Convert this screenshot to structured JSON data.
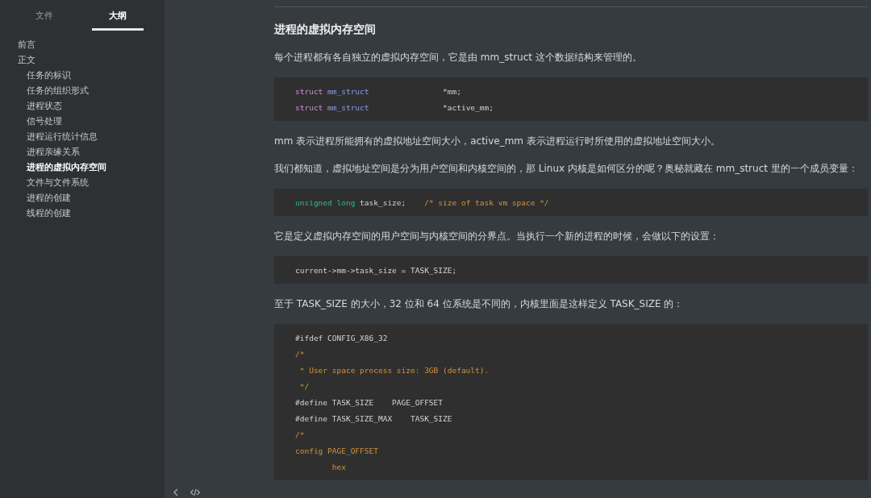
{
  "sidebar": {
    "tabs": [
      {
        "label": "文件",
        "selected": false
      },
      {
        "label": "大纲",
        "selected": true
      }
    ],
    "outline": [
      {
        "label": "前言",
        "selected": false
      },
      {
        "label": "正文",
        "selected": false,
        "children": [
          {
            "label": "任务的标识",
            "selected": false
          },
          {
            "label": "任务的组织形式",
            "selected": false
          },
          {
            "label": "进程状态",
            "selected": false
          },
          {
            "label": "信号处理",
            "selected": false
          },
          {
            "label": "进程运行统计信息",
            "selected": false
          },
          {
            "label": "进程亲缘关系",
            "selected": false
          },
          {
            "label": "进程的虚拟内存空间",
            "selected": true
          },
          {
            "label": "文件与文件系统",
            "selected": false
          },
          {
            "label": "进程的创建",
            "selected": false
          },
          {
            "label": "线程的创建",
            "selected": false
          }
        ]
      }
    ]
  },
  "content": [
    {
      "kind": "heading",
      "text": "进程的虚拟内存空间"
    },
    {
      "kind": "paragraph",
      "text": "每个进程都有各自独立的虚拟内存空间，它是由 mm_struct 这个数据结构来管理的。"
    },
    {
      "kind": "code",
      "lines": [
        [
          {
            "kind": "keyword",
            "text": "struct"
          },
          {
            "kind": "type",
            "text": " mm_struct"
          },
          {
            "kind": "plain",
            "text": "                *mm;"
          }
        ],
        [
          {
            "kind": "keyword",
            "text": "struct"
          },
          {
            "kind": "type",
            "text": " mm_struct"
          },
          {
            "kind": "plain",
            "text": "                *active_mm;"
          }
        ]
      ]
    },
    {
      "kind": "paragraph",
      "text": "mm 表示进程所能拥有的虚拟地址空间大小，active_mm 表示进程运行时所使用的虚拟地址空间大小。"
    },
    {
      "kind": "paragraph",
      "text": "我们都知道，虚拟地址空间是分为用户空间和内核空间的，那 Linux 内核是如何区分的呢？奥秘就藏在 mm_struct 里的一个成员变量："
    },
    {
      "kind": "code",
      "lines": [
        [
          {
            "kind": "builtin",
            "text": "unsigned long"
          },
          {
            "kind": "plain",
            "text": " task_size;    "
          },
          {
            "kind": "comment",
            "text": "/* size of task vm space */"
          }
        ]
      ]
    },
    {
      "kind": "paragraph",
      "text": "它是定义虚拟内存空间的用户空间与内核空间的分界点。当执行一个新的进程的时候，会做以下的设置："
    },
    {
      "kind": "code",
      "lines": [
        [
          {
            "kind": "plain",
            "text": "current->mm->task_size = TASK_SIZE;"
          }
        ]
      ]
    },
    {
      "kind": "paragraph",
      "text": "至于 TASK_SIZE 的大小，32 位和 64 位系统是不同的，内核里面是这样定义 TASK_SIZE 的："
    },
    {
      "kind": "code",
      "lines": [
        [
          {
            "kind": "plain",
            "text": "#ifdef CONFIG_X86_32"
          }
        ],
        [
          {
            "kind": "comment",
            "text": "/*"
          }
        ],
        [
          {
            "kind": "comment",
            "text": " * User space process size: 3GB (default)."
          }
        ],
        [
          {
            "kind": "comment",
            "text": " */"
          }
        ],
        [
          {
            "kind": "plain",
            "text": "#define TASK_SIZE    PAGE_OFFSET"
          }
        ],
        [
          {
            "kind": "plain",
            "text": "#define TASK_SIZE_MAX    TASK_SIZE"
          }
        ],
        [
          {
            "kind": "comment",
            "text": "/*"
          }
        ],
        [
          {
            "kind": "comment",
            "text": "config PAGE_OFFSET"
          }
        ],
        [
          {
            "kind": "comment",
            "text": "        hex"
          }
        ]
      ]
    }
  ]
}
